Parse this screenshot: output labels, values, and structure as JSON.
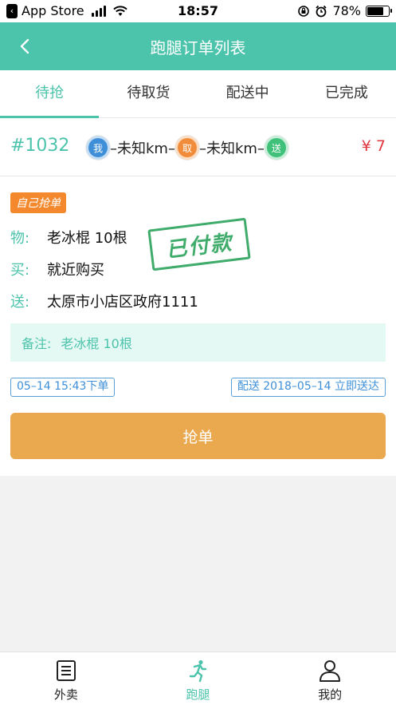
{
  "status_bar": {
    "back_app": "App Store",
    "time": "18:57",
    "battery": "78%"
  },
  "header": {
    "title": "跑腿订单列表"
  },
  "tabs": [
    {
      "label": "待抢",
      "active": true
    },
    {
      "label": "待取货",
      "active": false
    },
    {
      "label": "配送中",
      "active": false
    },
    {
      "label": "已完成",
      "active": false
    }
  ],
  "order": {
    "number": "#1032",
    "route": {
      "me_badge": "我",
      "pickup_badge": "取",
      "deliver_badge": "送",
      "seg1": "–未知km–",
      "seg2": "–未知km–"
    },
    "price": "¥ 7",
    "tag": "自己抢单",
    "item_label": "物:",
    "item_value": "老冰棍 10根",
    "buy_label": "买:",
    "buy_value": "就近购买",
    "deliver_label": "送:",
    "deliver_value": "太原市小店区政府1111",
    "stamp": "已付款",
    "remark_label": "备注:",
    "remark_value": "老冰棍 10根",
    "order_time": "05–14 15:43下单",
    "delivery_time": "配送 2018–05–14 立即送达",
    "grab_button": "抢单"
  },
  "bottom_nav": [
    {
      "label": "外卖",
      "icon": "list-icon",
      "active": false
    },
    {
      "label": "跑腿",
      "icon": "runner-icon",
      "active": true
    },
    {
      "label": "我的",
      "icon": "user-icon",
      "active": false
    }
  ],
  "colors": {
    "primary": "#4cc3ab",
    "grab_button": "#eaa84f",
    "price": "#e0383e",
    "tag": "#f3882d",
    "stamp": "#1f9e52"
  }
}
